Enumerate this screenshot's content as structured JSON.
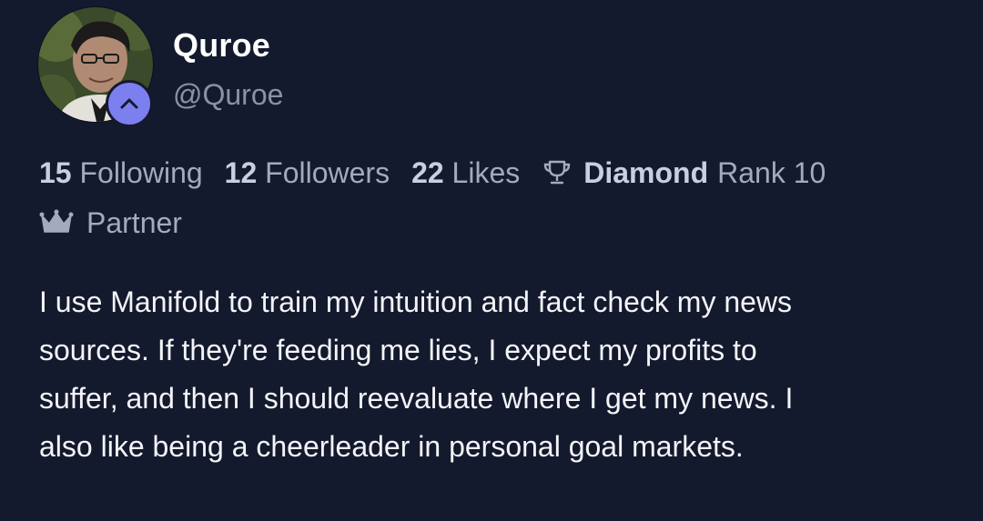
{
  "profile": {
    "display_name": "Quroe",
    "username": "@Quroe",
    "avatar_icon": "user-avatar",
    "badge_icon": "chevron-up-icon",
    "badge_color": "#7c7ff0"
  },
  "stats": {
    "following_count": "15",
    "following_label": "Following",
    "followers_count": "12",
    "followers_label": "Followers",
    "likes_count": "22",
    "likes_label": "Likes",
    "rank_icon": "trophy-icon",
    "league_tier": "Diamond",
    "rank_label": "Rank 10"
  },
  "partner": {
    "icon": "crown-icon",
    "label": "Partner"
  },
  "bio": {
    "lines": [
      "I use Manifold to train my intuition and fact check my news",
      "sources. If they're feeding me lies, I expect my profits to",
      "suffer, and then I should reevaluate where I get my news. I",
      "also like being a cheerleader in personal goal markets."
    ]
  },
  "colors": {
    "background": "#141a2d",
    "muted_text": "#a3a9bf",
    "strong_text": "#c9cee0"
  }
}
